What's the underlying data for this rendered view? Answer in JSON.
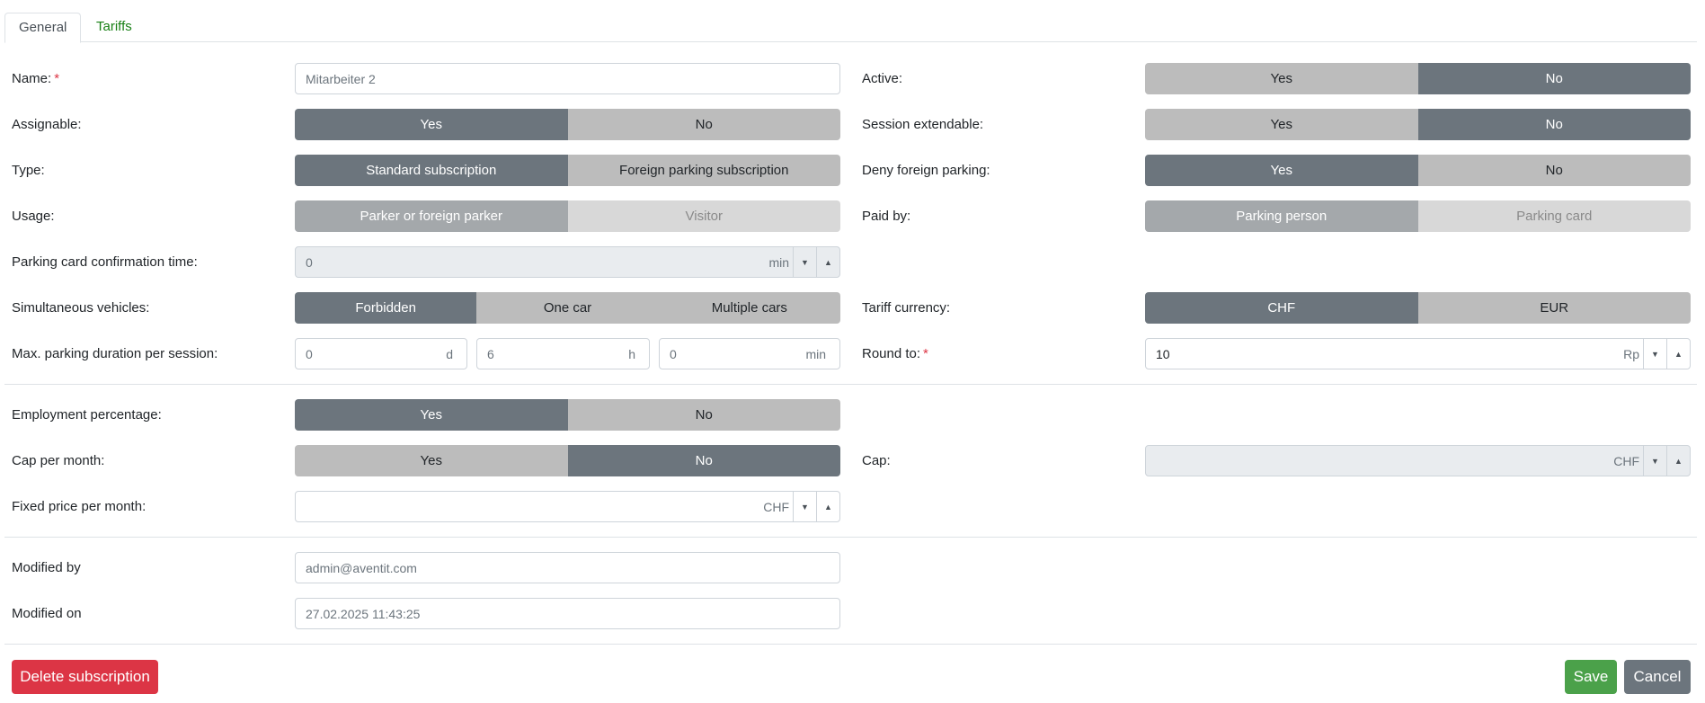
{
  "tabs": {
    "general": "General",
    "tariffs": "Tariffs"
  },
  "form": {
    "name": {
      "label": "Name:",
      "required": "*",
      "value": "Mitarbeiter 2"
    },
    "active": {
      "label": "Active:",
      "yes": "Yes",
      "no": "No",
      "selected": "No"
    },
    "assignable": {
      "label": "Assignable:",
      "yes": "Yes",
      "no": "No",
      "selected": "Yes"
    },
    "session_extendable": {
      "label": "Session extendable:",
      "yes": "Yes",
      "no": "No",
      "selected": "No"
    },
    "type": {
      "label": "Type:",
      "opt1": "Standard subscription",
      "opt2": "Foreign parking subscription",
      "selected": "Standard subscription"
    },
    "deny_foreign_parking": {
      "label": "Deny foreign parking:",
      "yes": "Yes",
      "no": "No",
      "selected": "Yes"
    },
    "usage": {
      "label": "Usage:",
      "opt1": "Parker or foreign parker",
      "opt2": "Visitor",
      "selected": "Parker or foreign parker"
    },
    "paid_by": {
      "label": "Paid by:",
      "opt1": "Parking person",
      "opt2": "Parking card",
      "selected": "Parking person"
    },
    "parking_card_confirmation_time": {
      "label": "Parking card confirmation time:",
      "value": "0",
      "unit": "min"
    },
    "simultaneous_vehicles": {
      "label": "Simultaneous vehicles:",
      "opt1": "Forbidden",
      "opt2": "One car",
      "opt3": "Multiple cars",
      "selected": "Forbidden"
    },
    "tariff_currency": {
      "label": "Tariff currency:",
      "opt1": "CHF",
      "opt2": "EUR",
      "selected": "CHF"
    },
    "max_parking_duration": {
      "label": "Max. parking duration per session:",
      "days": "0",
      "days_unit": "d",
      "hours": "6",
      "hours_unit": "h",
      "minutes": "0",
      "minutes_unit": "min"
    },
    "round_to": {
      "label": "Round to:",
      "required": "*",
      "value": "10",
      "unit": "Rp"
    },
    "employment_percentage": {
      "label": "Employment percentage:",
      "yes": "Yes",
      "no": "No",
      "selected": "Yes"
    },
    "cap_per_month": {
      "label": "Cap per month:",
      "yes": "Yes",
      "no": "No",
      "selected": "No"
    },
    "cap": {
      "label": "Cap:",
      "value": "",
      "unit": "CHF"
    },
    "fixed_price_per_month": {
      "label": "Fixed price per month:",
      "value": "",
      "unit": "CHF"
    },
    "modified_by": {
      "label": "Modified by",
      "value": "admin@aventit.com"
    },
    "modified_on": {
      "label": "Modified on",
      "value": "27.02.2025 11:43:25"
    }
  },
  "actions": {
    "delete": "Delete subscription",
    "save": "Save",
    "cancel": "Cancel"
  },
  "colors": {
    "accent": "#6c757d",
    "danger": "#dc3545",
    "success": "#4ba14a",
    "tab_link": "#198016"
  },
  "icons": {
    "spin_down": "caret-down-icon",
    "spin_up": "caret-up-icon"
  }
}
